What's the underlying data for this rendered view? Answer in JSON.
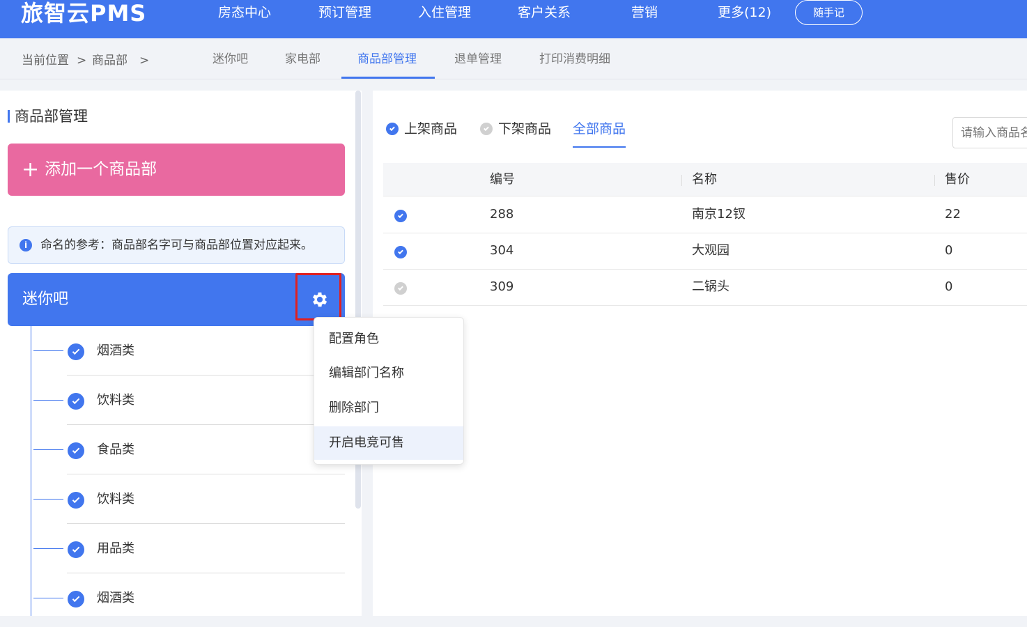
{
  "app": {
    "logo": "旅智云PMS",
    "memo_button": "随手记"
  },
  "nav": [
    "房态中心",
    "预订管理",
    "入住管理",
    "客户关系",
    "营销",
    "更多(12)"
  ],
  "breadcrumb": {
    "current": "当前位置",
    "sep1": ">",
    "section": "商品部",
    "sep2": ">"
  },
  "subtabs": [
    "迷你吧",
    "家电部",
    "商品部管理",
    "退单管理",
    "打印消费明细"
  ],
  "left": {
    "title": "商品部管理",
    "add_button": "添加一个商品部",
    "info_text": "命名的参考：商品部名字可与商品部位置对应起来。",
    "dept_name": "迷你吧",
    "categories": [
      "烟酒类",
      "饮料类",
      "食品类",
      "饮料类",
      "用品类",
      "烟酒类"
    ]
  },
  "dropdown": [
    "配置角色",
    "编辑部门名称",
    "删除部门",
    "开启电竞可售"
  ],
  "right": {
    "filters": [
      "上架商品",
      "下架商品",
      "全部商品"
    ],
    "search_placeholder": "请输入商品名",
    "columns": [
      "编号",
      "名称",
      "售价"
    ],
    "rows": [
      {
        "id": "288",
        "name": "南京12钗",
        "price": "22",
        "on_shelf": true
      },
      {
        "id": "304",
        "name": "大观园",
        "price": "0",
        "on_shelf": true
      },
      {
        "id": "309",
        "name": "二锅头",
        "price": "0",
        "on_shelf": false
      }
    ]
  },
  "colors": {
    "primary": "#4176ee",
    "pink": "#e969a0",
    "red_highlight": "#e02020",
    "inactive": "#d0d0d0"
  }
}
